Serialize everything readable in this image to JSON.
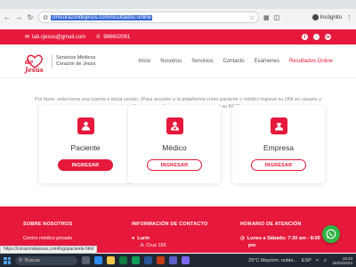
{
  "browser": {
    "url": "cmicorazondejesus.com/resultados-online",
    "profile_label": "Incógnito"
  },
  "topbar": {
    "email": "lab.cjesus@gmail.com",
    "phone": "986602091"
  },
  "header": {
    "logo_script": "de Jesús",
    "logo_line1": "Servicios Médicos",
    "logo_line2": "Corazón de Jesús",
    "nav": [
      {
        "label": "Inicio"
      },
      {
        "label": "Nosotros"
      },
      {
        "label": "Servicios"
      },
      {
        "label": "Contacto"
      },
      {
        "label": "Exámenes"
      },
      {
        "label": "Resultados Online"
      }
    ]
  },
  "intro": {
    "text": "Por favor, selecciona una cuenta e inicia sesión. (Para acceder a la plataforma como paciente o médico ingrese su DNI en usuario y contraseña, para acceder como empresa ingrese su RUC)."
  },
  "cards": [
    {
      "title": "Paciente",
      "button": "INGRESAR"
    },
    {
      "title": "Médico",
      "button": "INGRESAR"
    },
    {
      "title": "Empresa",
      "button": "INGRESAR"
    }
  ],
  "footer": {
    "about_heading": "SOBRE NOSOTROS",
    "about_text": "Centro médico privado",
    "contact_heading": "INFORMACIÓN DE CONTACTO",
    "contact_city": "Lurín",
    "contact_address": "Jr. Cruz 155",
    "hours_heading": "HORARIO DE ATENCIÓN",
    "hours_line": "Lunes a Sábado: 7:30 am - 8:00",
    "hours_line2": "pm"
  },
  "status_link": "https://corazondejesus.com/logopaciente.html",
  "taskbar": {
    "search_placeholder": "Buscar",
    "weather": "25°C  Mayorm. nubla...",
    "language": "ESP",
    "time": "16:43",
    "date": "26/03/2024"
  },
  "colors": {
    "brand_red": "#e6193c",
    "whatsapp_green": "#2fb344"
  }
}
